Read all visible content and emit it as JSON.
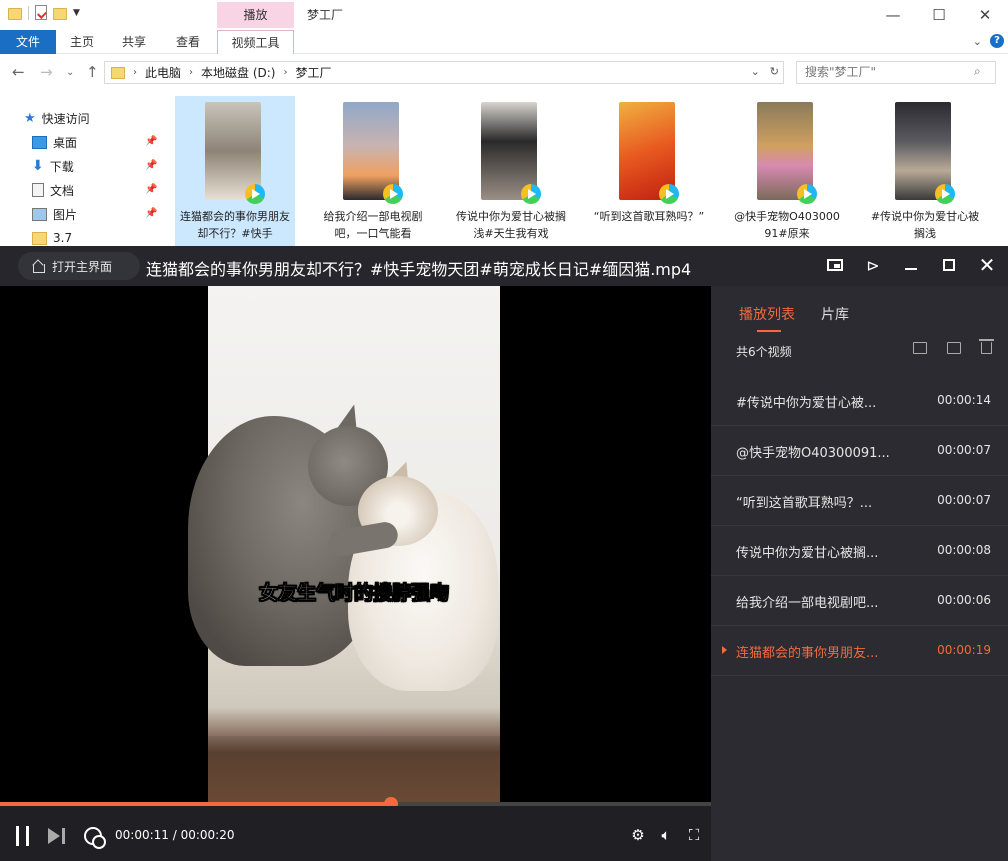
{
  "explorer": {
    "title": "梦工厂",
    "context_tab_group": "播放",
    "ribbon_tabs": [
      "文件",
      "主页",
      "共享",
      "查看",
      "视频工具"
    ],
    "address": [
      "此电脑",
      "本地磁盘 (D:)",
      "梦工厂"
    ],
    "search_placeholder": "搜索\"梦工厂\"",
    "nav": {
      "quick_access": "快速访问",
      "items": [
        "桌面",
        "下载",
        "文档",
        "图片",
        "3.7"
      ]
    },
    "files": [
      {
        "name": "连猫都会的事你男朋友却不行？#快手"
      },
      {
        "name": "给我介绍一部电视剧吧，一口气能看"
      },
      {
        "name": "传说中你为爱甘心被搁浅#天生我有戏"
      },
      {
        "name": "“听到这首歌耳熟吗？”"
      },
      {
        "name": "@快手宠物O40300091#原来"
      },
      {
        "name": "#传说中你为爱甘心被搁浅"
      }
    ],
    "icons": {
      "min": "minimize-icon",
      "max": "maximize-icon",
      "close": "close-icon"
    }
  },
  "player": {
    "home_button": "打开主界面",
    "title": "连猫都会的事你男朋友却不行？#快手宠物天团#萌宠成长日记#缅因猫.mp4",
    "subtitle": "女友生气时的搂脖强吻",
    "time_current": "00:00:11",
    "time_total": "00:00:20",
    "progress": 0.55,
    "accent_color": "#f26a3d",
    "sidebar": {
      "tabs": [
        "播放列表",
        "片库"
      ],
      "count_label": "共6个视频",
      "playlist": [
        {
          "name": "#传说中你为爱甘心被...",
          "duration": "00:00:14"
        },
        {
          "name": "@快手宠物O40300091...",
          "duration": "00:00:07"
        },
        {
          "name": "“听到这首歌耳熟吗？...",
          "duration": "00:00:07"
        },
        {
          "name": "传说中你为爱甘心被搁...",
          "duration": "00:00:08"
        },
        {
          "name": "给我介绍一部电视剧吧...",
          "duration": "00:00:06"
        },
        {
          "name": "连猫都会的事你男朋友...",
          "duration": "00:00:19",
          "current": true
        }
      ]
    }
  }
}
